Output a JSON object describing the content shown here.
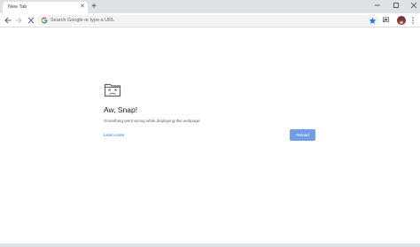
{
  "tab": {
    "title": "New Tab",
    "close_icon": "close-icon"
  },
  "window_controls": [
    "minimize-icon",
    "maximize-icon",
    "close-icon"
  ],
  "toolbar": {
    "back_icon": "arrow-left-icon",
    "forward_icon": "arrow-right-icon",
    "stop_icon": "stop-icon",
    "omnibox_placeholder": "Search Google or type a URL",
    "bookmark_icon": "star-icon",
    "cast_icon": "cast-icon",
    "menu_icon": "kebab-menu-icon"
  },
  "error": {
    "icon": "sad-tab-icon",
    "title": "Aw, Snap!",
    "description": "Something went wrong while displaying this webpage.",
    "learn_more": "Learn more",
    "reload": "Reload"
  },
  "colors": {
    "accent": "#1a73e8",
    "reload_button": "#6e9ee8",
    "bookmark_star": "#1a73e8",
    "tabstrip": "#dee1e6"
  }
}
